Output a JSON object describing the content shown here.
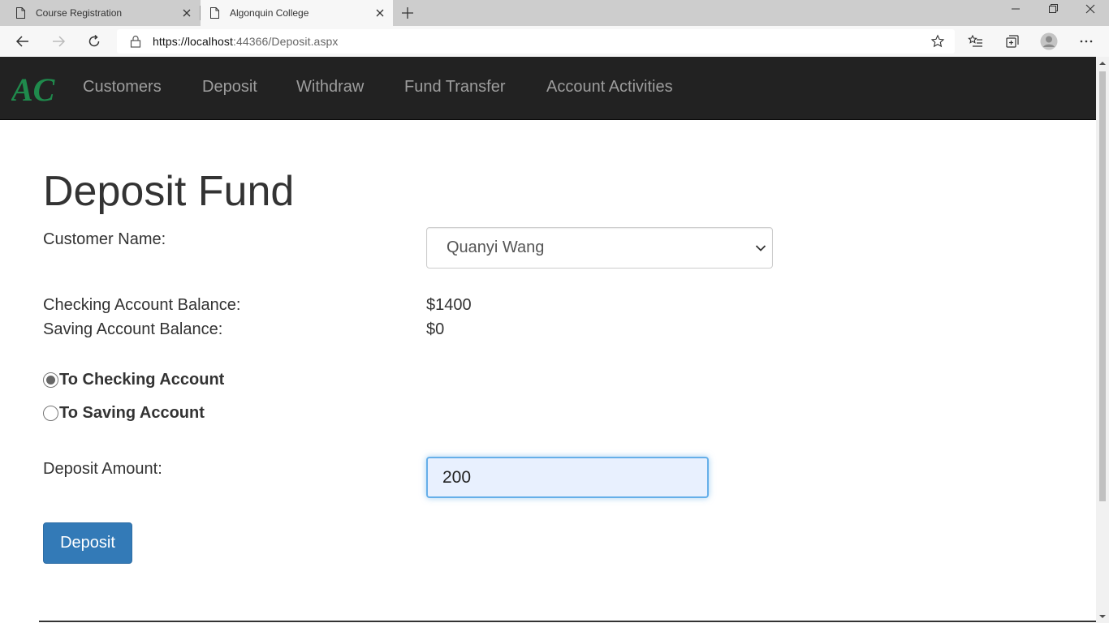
{
  "browser": {
    "tabs": [
      {
        "title": "Course Registration",
        "active": false
      },
      {
        "title": "Algonquin College",
        "active": true
      }
    ],
    "url": {
      "scheme_host": "https://localhost",
      "rest": ":44366/Deposit.aspx"
    }
  },
  "navbar": {
    "logo_text": "AC",
    "links": [
      "Customers",
      "Deposit",
      "Withdraw",
      "Fund Transfer",
      "Account Activities"
    ]
  },
  "page": {
    "title": "Deposit Fund",
    "customer_label": "Customer Name:",
    "customer_selected": "Quanyi Wang",
    "checking_label": "Checking Account Balance:",
    "checking_value": "$1400",
    "saving_label": "Saving Account Balance:",
    "saving_value": "$0",
    "radio_checking": "To Checking Account",
    "radio_saving": "To Saving Account",
    "radio_selected": "checking",
    "amount_label": "Deposit Amount:",
    "amount_value": "200",
    "deposit_button": "Deposit"
  },
  "colors": {
    "navbar_bg": "#222222",
    "nav_link": "#9d9d9d",
    "logo_green": "#1f8a4c",
    "button_primary": "#337ab7",
    "input_focus": "#66afe9"
  }
}
